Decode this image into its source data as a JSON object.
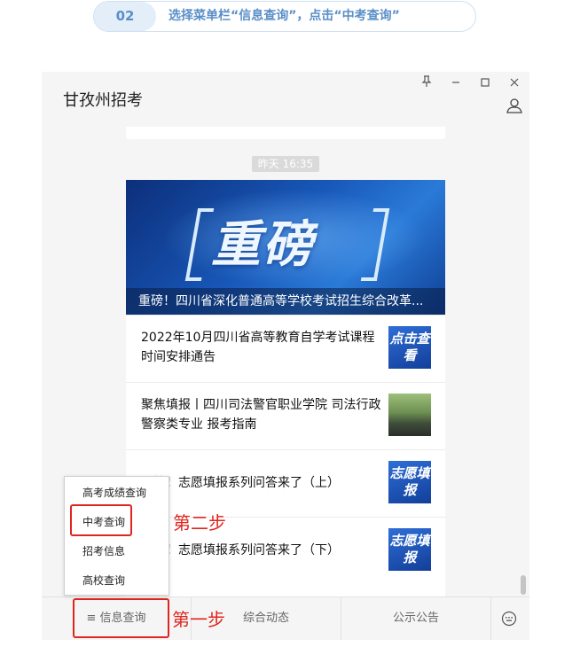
{
  "step": {
    "number": "02",
    "instruction": "选择菜单栏“信息查询”，点击“中考查询”"
  },
  "window": {
    "title": "甘孜州招考"
  },
  "chat": {
    "timestamp": "昨天 16:35",
    "banner": {
      "headline": "重磅",
      "caption": "重磅！四川省深化普通高等学校考试招生综合改革..."
    },
    "items": [
      {
        "text": "2022年10月四川省高等教育自学考试课程时间安排通告",
        "thumb_text": "点击查看",
        "thumb_type": "blue"
      },
      {
        "text": "聚焦填报丨四川司法警官职业学院 司法行政警察类专业 报考指南",
        "thumb_text": "",
        "thumb_type": "photo"
      },
      {
        "text": "必答！志愿填报系列问答来了（上）",
        "thumb_text": "志愿填报",
        "thumb_type": "blue"
      },
      {
        "text": "必答！志愿填报系列问答来了（下）",
        "thumb_text": "志愿填报",
        "thumb_type": "blue"
      }
    ]
  },
  "menu": {
    "items": [
      {
        "label": "≡ 信息查询"
      },
      {
        "label": "综合动态"
      },
      {
        "label": "公示公告"
      }
    ],
    "popup": [
      "高考成绩查询",
      "中考查询",
      "招考信息",
      "高校查询"
    ]
  },
  "annotations": {
    "step1": "第一步",
    "step2": "第二步"
  },
  "colors": {
    "highlight": "#e0251e",
    "step_accent": "#5a8fc7",
    "banner_blue": "#1857b8"
  }
}
